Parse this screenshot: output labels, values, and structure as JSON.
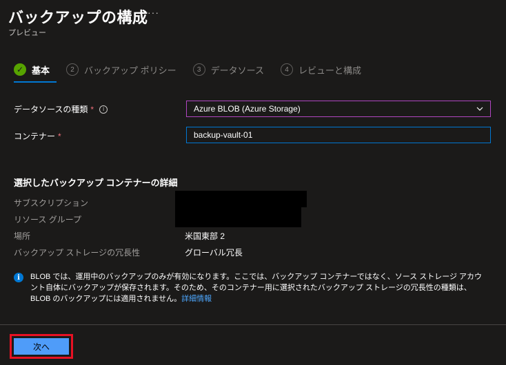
{
  "header": {
    "title": "バックアップの構成",
    "more_label": "···",
    "subtitle": "プレビュー"
  },
  "steps": [
    {
      "number": "",
      "label": "基本",
      "state": "done"
    },
    {
      "number": "2",
      "label": "バックアップ ポリシー",
      "state": "pending"
    },
    {
      "number": "3",
      "label": "データソース",
      "state": "pending"
    },
    {
      "number": "4",
      "label": "レビューと構成",
      "state": "pending"
    }
  ],
  "form": {
    "datasource_label": "データソースの種類",
    "datasource_value": "Azure BLOB (Azure Storage)",
    "container_label": "コンテナー",
    "container_value": "backup-vault-01",
    "required_mark": "*",
    "info_glyph": "i"
  },
  "details": {
    "section_title": "選択したバックアップ コンテナーの詳細",
    "subscription_label": "サブスクリプション",
    "resource_group_label": "リソース グループ",
    "location_label": "場所",
    "location_value": "米国東部 2",
    "redundancy_label": "バックアップ ストレージの冗長性",
    "redundancy_value": "グローバル冗長"
  },
  "infobar": {
    "glyph": "i",
    "text": "BLOB では、運用中のバックアップのみが有効になります。ここでは、バックアップ コンテナーではなく、ソース ストレージ アカウント自体にバックアップが保存されます。そのため、そのコンテナー用に選択されたバックアップ ストレージの冗長性の種類は、BLOB のバックアップには適用されません。",
    "link": "詳細情報"
  },
  "footer": {
    "next_label": "次へ"
  },
  "colors": {
    "background": "#1b1a19",
    "accent": "#0078d4",
    "success": "#57a300",
    "required": "#f1707b",
    "highlight_outline": "#e81123"
  }
}
